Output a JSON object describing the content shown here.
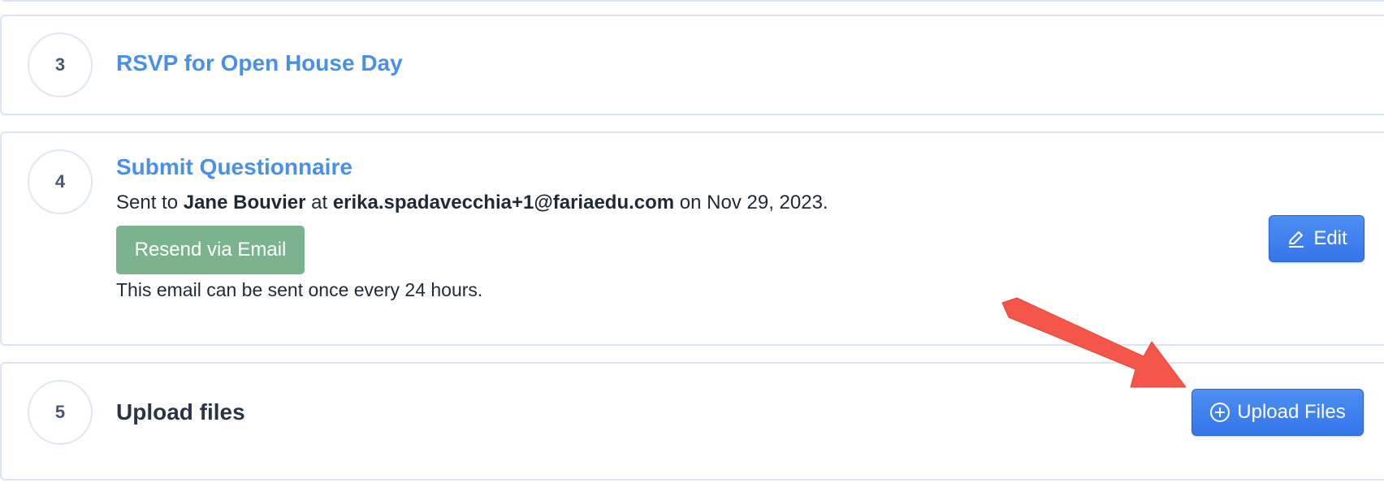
{
  "steps": [
    {
      "number": "3",
      "title": "RSVP for Open House Day"
    },
    {
      "number": "4",
      "title": "Submit Questionnaire",
      "sent": {
        "prefix": "Sent to",
        "recipient": "Jane Bouvier",
        "at": "at",
        "email": "erika.spadavecchia+1@fariaedu.com",
        "date_text": "on Nov 29, 2023."
      },
      "resend_label": "Resend via Email",
      "note": "This email can be sent once every 24 hours.",
      "edit_label": "Edit"
    },
    {
      "number": "5",
      "title": "Upload files",
      "upload_label": "Upload Files"
    }
  ],
  "colors": {
    "link": "#4a8fe8",
    "primary_button": "#3b7ded",
    "resend_button": "#7ab38d",
    "annotation_arrow": "#f4564a",
    "card_border": "#dbe4f0"
  },
  "icons": {
    "edit": "pencil-icon",
    "upload": "plus-circle-icon"
  }
}
